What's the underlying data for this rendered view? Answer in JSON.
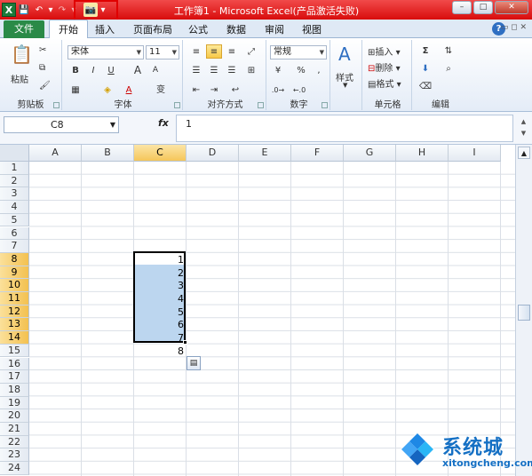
{
  "window": {
    "title": "工作簿1 - Microsoft Excel(产品激活失败)",
    "min": "–",
    "max": "□",
    "close": "✕"
  },
  "qat": {
    "excel_logo": "X",
    "save": "💾",
    "undo": "↶",
    "undo_drop": "▾",
    "redo": "↷",
    "redo_drop": "▾",
    "custom": "📷",
    "more": "▾"
  },
  "tabs": {
    "file": "文件",
    "items": [
      "开始",
      "插入",
      "页面布局",
      "公式",
      "数据",
      "审阅",
      "视图"
    ],
    "active": "开始",
    "help": "?"
  },
  "ribbon": {
    "clipboard": {
      "label": "剪贴板",
      "paste": "粘贴"
    },
    "font": {
      "label": "字体",
      "font_name": "宋体",
      "font_size": "11",
      "bold": "B",
      "italic": "I",
      "underline": "U",
      "grow": "A",
      "shrink": "A",
      "wen": "变"
    },
    "alignment": {
      "label": "对齐方式"
    },
    "number": {
      "label": "数字",
      "format": "常规",
      "percent": "%",
      "comma": ","
    },
    "styles": {
      "label": "样式",
      "button": "样式"
    },
    "cells": {
      "label": "单元格",
      "insert": "插入",
      "delete": "删除",
      "format": "格式"
    },
    "editing": {
      "label": "编辑",
      "sum": "Σ"
    }
  },
  "formula_bar": {
    "name_box": "C8",
    "fx": "fx",
    "value": "1"
  },
  "grid": {
    "columns": [
      "A",
      "B",
      "C",
      "D",
      "E",
      "F",
      "G",
      "H",
      "I"
    ],
    "selected_column": "C",
    "rows": [
      "1",
      "2",
      "3",
      "4",
      "5",
      "6",
      "7",
      "8",
      "9",
      "10",
      "11",
      "12",
      "13",
      "14",
      "15",
      "16",
      "17",
      "18",
      "19",
      "20",
      "21",
      "22",
      "23",
      "24"
    ],
    "selected_rows": [
      "8",
      "9",
      "10",
      "11",
      "12",
      "13",
      "14"
    ],
    "column_c_values": [
      "1",
      "2",
      "3",
      "4",
      "5",
      "6",
      "7",
      "8"
    ]
  },
  "watermark": {
    "text": "系统城",
    "url": "xitongcheng.com"
  }
}
